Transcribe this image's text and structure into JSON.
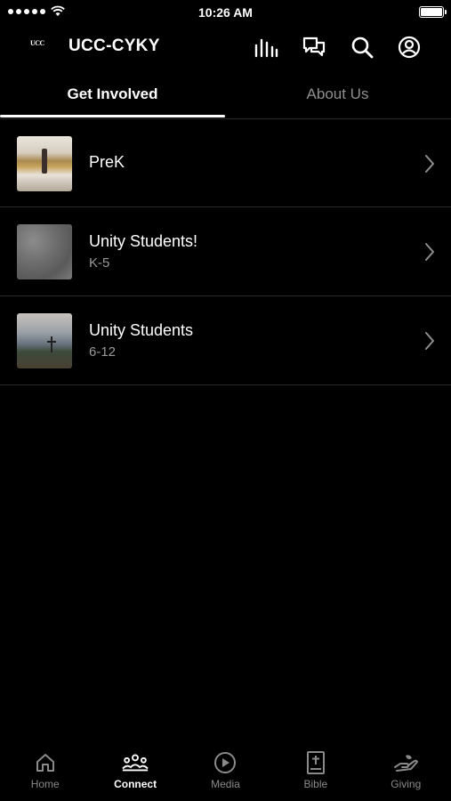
{
  "status_bar": {
    "time": "10:26 AM"
  },
  "header": {
    "logo_text": "UCC",
    "title": "UCC-CYKY",
    "icons": [
      "sermon-icon",
      "chat-icon",
      "search-icon",
      "profile-icon"
    ]
  },
  "tabs": [
    {
      "label": "Get Involved",
      "active": true
    },
    {
      "label": "About Us",
      "active": false
    }
  ],
  "items": [
    {
      "title": "PreK",
      "subtitle": ""
    },
    {
      "title": "Unity Students!",
      "subtitle": "K-5"
    },
    {
      "title": "Unity Students",
      "subtitle": "6-12"
    }
  ],
  "bottom_nav": [
    {
      "label": "Home",
      "icon": "home-icon",
      "active": false
    },
    {
      "label": "Connect",
      "icon": "people-icon",
      "active": true
    },
    {
      "label": "Media",
      "icon": "play-icon",
      "active": false
    },
    {
      "label": "Bible",
      "icon": "bible-icon",
      "active": false
    },
    {
      "label": "Giving",
      "icon": "giving-icon",
      "active": false
    }
  ],
  "colors": {
    "background": "#000000",
    "text": "#ffffff",
    "muted": "#8e8e8e",
    "divider": "#2a2a2a"
  }
}
